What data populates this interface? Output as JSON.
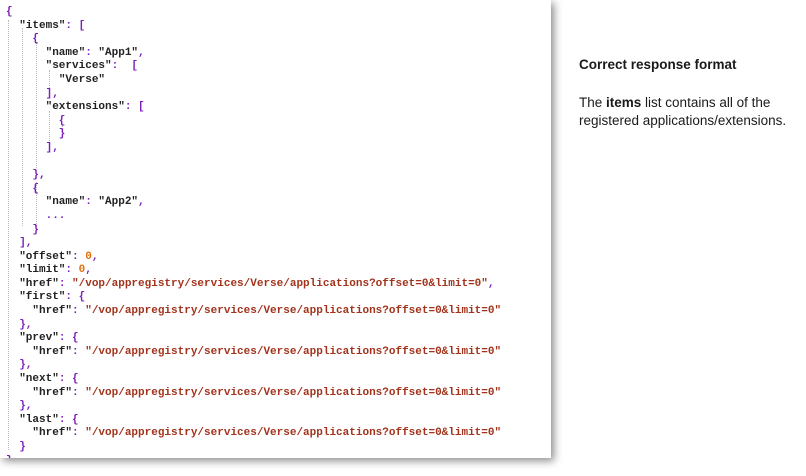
{
  "colors": {
    "punctuation": "#7a1fb8",
    "key": "#222222",
    "string": "#a2331c",
    "number": "#e0700c",
    "plain": "#222222"
  },
  "code": [
    [
      {
        "t": "{",
        "k": "punctuation"
      }
    ],
    [
      {
        "t": "  ",
        "k": "plain"
      },
      {
        "t": "\"items\"",
        "k": "key"
      },
      {
        "t": ": [",
        "k": "punctuation"
      }
    ],
    [
      {
        "t": "    {",
        "k": "punctuation"
      }
    ],
    [
      {
        "t": "      ",
        "k": "plain"
      },
      {
        "t": "\"name\"",
        "k": "key"
      },
      {
        "t": ": ",
        "k": "punctuation"
      },
      {
        "t": "\"App1\"",
        "k": "key"
      },
      {
        "t": ",",
        "k": "punctuation"
      }
    ],
    [
      {
        "t": "      ",
        "k": "plain"
      },
      {
        "t": "\"services\"",
        "k": "key"
      },
      {
        "t": ":  [",
        "k": "punctuation"
      }
    ],
    [
      {
        "t": "        ",
        "k": "plain"
      },
      {
        "t": "\"Verse\"",
        "k": "key"
      }
    ],
    [
      {
        "t": "      ],",
        "k": "punctuation"
      }
    ],
    [
      {
        "t": "      ",
        "k": "plain"
      },
      {
        "t": "\"extensions\"",
        "k": "key"
      },
      {
        "t": ": [",
        "k": "punctuation"
      }
    ],
    [
      {
        "t": "        {",
        "k": "punctuation"
      }
    ],
    [
      {
        "t": "        }",
        "k": "punctuation"
      }
    ],
    [
      {
        "t": "      ],",
        "k": "punctuation"
      }
    ],
    [
      {
        "t": "",
        "k": "plain"
      }
    ],
    [
      {
        "t": "    },",
        "k": "punctuation"
      }
    ],
    [
      {
        "t": "    {",
        "k": "punctuation"
      }
    ],
    [
      {
        "t": "      ",
        "k": "plain"
      },
      {
        "t": "\"name\"",
        "k": "key"
      },
      {
        "t": ": ",
        "k": "punctuation"
      },
      {
        "t": "\"App2\"",
        "k": "key"
      },
      {
        "t": ",",
        "k": "punctuation"
      }
    ],
    [
      {
        "t": "      ...",
        "k": "punctuation"
      }
    ],
    [
      {
        "t": "    }",
        "k": "punctuation"
      }
    ],
    [
      {
        "t": "  ],",
        "k": "punctuation"
      }
    ],
    [
      {
        "t": "  ",
        "k": "plain"
      },
      {
        "t": "\"offset\"",
        "k": "key"
      },
      {
        "t": ": ",
        "k": "punctuation"
      },
      {
        "t": "0",
        "k": "number"
      },
      {
        "t": ",",
        "k": "punctuation"
      }
    ],
    [
      {
        "t": "  ",
        "k": "plain"
      },
      {
        "t": "\"limit\"",
        "k": "key"
      },
      {
        "t": ": ",
        "k": "punctuation"
      },
      {
        "t": "0",
        "k": "number"
      },
      {
        "t": ",",
        "k": "punctuation"
      }
    ],
    [
      {
        "t": "  ",
        "k": "plain"
      },
      {
        "t": "\"href\"",
        "k": "key"
      },
      {
        "t": ": ",
        "k": "punctuation"
      },
      {
        "t": "\"/vop/appregistry/services/Verse/applications?offset=0&limit=0\"",
        "k": "string"
      },
      {
        "t": ",",
        "k": "punctuation"
      }
    ],
    [
      {
        "t": "  ",
        "k": "plain"
      },
      {
        "t": "\"first\"",
        "k": "key"
      },
      {
        "t": ": {",
        "k": "punctuation"
      }
    ],
    [
      {
        "t": "    ",
        "k": "plain"
      },
      {
        "t": "\"href\"",
        "k": "key"
      },
      {
        "t": ": ",
        "k": "punctuation"
      },
      {
        "t": "\"/vop/appregistry/services/Verse/applications?offset=0&limit=0\"",
        "k": "string"
      }
    ],
    [
      {
        "t": "  },",
        "k": "punctuation"
      }
    ],
    [
      {
        "t": "  ",
        "k": "plain"
      },
      {
        "t": "\"prev\"",
        "k": "key"
      },
      {
        "t": ": {",
        "k": "punctuation"
      }
    ],
    [
      {
        "t": "    ",
        "k": "plain"
      },
      {
        "t": "\"href\"",
        "k": "key"
      },
      {
        "t": ": ",
        "k": "punctuation"
      },
      {
        "t": "\"/vop/appregistry/services/Verse/applications?offset=0&limit=0\"",
        "k": "string"
      }
    ],
    [
      {
        "t": "  },",
        "k": "punctuation"
      }
    ],
    [
      {
        "t": "  ",
        "k": "plain"
      },
      {
        "t": "\"next\"",
        "k": "key"
      },
      {
        "t": ": {",
        "k": "punctuation"
      }
    ],
    [
      {
        "t": "    ",
        "k": "plain"
      },
      {
        "t": "\"href\"",
        "k": "key"
      },
      {
        "t": ": ",
        "k": "punctuation"
      },
      {
        "t": "\"/vop/appregistry/services/Verse/applications?offset=0&limit=0\"",
        "k": "string"
      }
    ],
    [
      {
        "t": "  },",
        "k": "punctuation"
      }
    ],
    [
      {
        "t": "  ",
        "k": "plain"
      },
      {
        "t": "\"last\"",
        "k": "key"
      },
      {
        "t": ": {",
        "k": "punctuation"
      }
    ],
    [
      {
        "t": "    ",
        "k": "plain"
      },
      {
        "t": "\"href\"",
        "k": "key"
      },
      {
        "t": ": ",
        "k": "punctuation"
      },
      {
        "t": "\"/vop/appregistry/services/Verse/applications?offset=0&limit=0\"",
        "k": "string"
      }
    ],
    [
      {
        "t": "  }",
        "k": "punctuation"
      }
    ],
    [
      {
        "t": "}",
        "k": "punctuation"
      }
    ]
  ],
  "note": {
    "title": "Correct response format",
    "body_prefix": "The ",
    "body_strong": "items",
    "body_suffix": " list contains all of the registered applications/extensions."
  }
}
